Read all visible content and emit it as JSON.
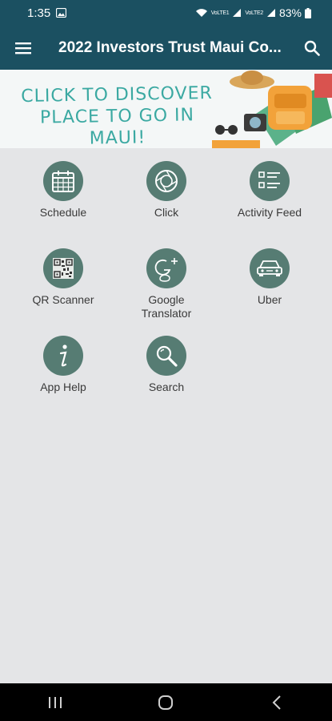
{
  "status_bar": {
    "time": "1:35",
    "battery_percent": "83%",
    "signal_label_1": "VoLTE1",
    "signal_label_2": "VoLTE2"
  },
  "app_bar": {
    "title": "2022 Investors Trust Maui Co...",
    "menu_icon": "hamburger-menu-icon",
    "search_icon": "search-icon"
  },
  "banner": {
    "text": "CLICK TO DISCOVER PLACE TO GO IN MAUI!"
  },
  "tiles": [
    {
      "label": "Schedule",
      "icon": "calendar-icon"
    },
    {
      "label": "Click",
      "icon": "camera-aperture-icon"
    },
    {
      "label": "Activity Feed",
      "icon": "list-icon"
    },
    {
      "label": "QR Scanner",
      "icon": "qr-code-icon"
    },
    {
      "label": "Google\nTranslator",
      "icon": "google-plus-icon"
    },
    {
      "label": "Uber",
      "icon": "car-icon"
    },
    {
      "label": "App Help",
      "icon": "info-icon"
    },
    {
      "label": "Search",
      "icon": "magnifier-icon"
    }
  ],
  "colors": {
    "app_bar": "#1b5061",
    "tile_circle": "#567c73",
    "background": "#e4e5e7",
    "banner_text": "#3ba9a2"
  }
}
